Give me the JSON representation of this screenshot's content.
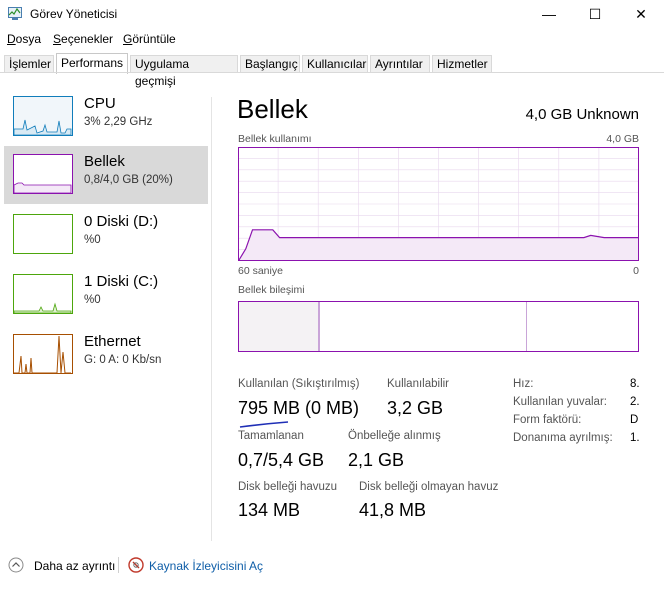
{
  "window": {
    "title": "Görev Yöneticisi",
    "minimize_glyph": "—",
    "maximize_glyph": "☐",
    "close_glyph": "✕"
  },
  "menu": [
    {
      "label": "Dosya",
      "underline_char": "D"
    },
    {
      "label": "Seçenekler",
      "underline_char": "S"
    },
    {
      "label": "Görüntüle",
      "underline_char": "G"
    }
  ],
  "tabs": [
    "İşlemler",
    "Performans",
    "Uygulama geçmişi",
    "Başlangıç",
    "Kullanıcılar",
    "Ayrıntılar",
    "Hizmetler"
  ],
  "active_tab": "Performans",
  "resources": [
    {
      "name": "CPU",
      "sub": "3%  2,29 GHz",
      "color": "#117dbb",
      "fill": "#f1f6fa"
    },
    {
      "name": "Bellek",
      "sub": "0,8/4,0 GB (20%)",
      "color": "#8b12ae",
      "fill": "#f4f2f4"
    },
    {
      "name": "0 Diski (D:)",
      "sub": "%0",
      "color": "#4da60c",
      "fill": "#eff7e7"
    },
    {
      "name": "1 Diski (C:)",
      "sub": "%0",
      "color": "#4da60c",
      "fill": "#eff7e7"
    },
    {
      "name": "Ethernet",
      "sub": "G: 0 A: 0 Kb/sn",
      "color": "#a74f01",
      "fill": "#fcf3eb"
    }
  ],
  "panel": {
    "title": "Bellek",
    "total": "4,0 GB Unknown",
    "usage_label": "Bellek kullanımı",
    "usage_max": "4,0 GB",
    "axis_left": "60 saniye",
    "axis_right": "0",
    "composition_label": "Bellek bileşimi",
    "accent_color": "#8b12ae",
    "usage_fraction_history": [
      0,
      0.1,
      0.27,
      0.27,
      0.27,
      0.27,
      0.2,
      0.2,
      0.2,
      0.2,
      0.2,
      0.2,
      0.2,
      0.2,
      0.2,
      0.2,
      0.2,
      0.2,
      0.2,
      0.2,
      0.2,
      0.2,
      0.2,
      0.2,
      0.2,
      0.2,
      0.2,
      0.2,
      0.2,
      0.2,
      0.2,
      0.2,
      0.2,
      0.2,
      0.2,
      0.2,
      0.2,
      0.2,
      0.2,
      0.2,
      0.2,
      0.2,
      0.2,
      0.2,
      0.2,
      0.2,
      0.2,
      0.2,
      0.2,
      0.2,
      0.2,
      0.2,
      0.22,
      0.21,
      0.2,
      0.2,
      0.2,
      0.2,
      0.2,
      0.2
    ]
  },
  "stats": {
    "in_use_label": "Kullanılan (Sıkıştırılmış)",
    "in_use_value": "795 MB (0 MB)",
    "available_label": "Kullanılabilir",
    "available_value": "3,2 GB",
    "committed_label": "Tamamlanan",
    "committed_value": "0,7/5,4 GB",
    "cached_label": "Önbelleğe alınmış",
    "cached_value": "2,1 GB",
    "paged_label": "Disk belleği havuzu",
    "paged_value": "134 MB",
    "nonpaged_label": "Disk belleği olmayan havuz",
    "nonpaged_value": "41,8 MB"
  },
  "props": [
    {
      "label": "Hız:",
      "value": "8."
    },
    {
      "label": "Kullanılan yuvalar:",
      "value": "2."
    },
    {
      "label": "Form faktörü:",
      "value": "D"
    },
    {
      "label": "Donanıma ayrılmış:",
      "value": "1."
    }
  ],
  "footer": {
    "fewer_details": "Daha az ayrıntı",
    "resource_monitor": "Kaynak İzleyicisini Aç"
  }
}
